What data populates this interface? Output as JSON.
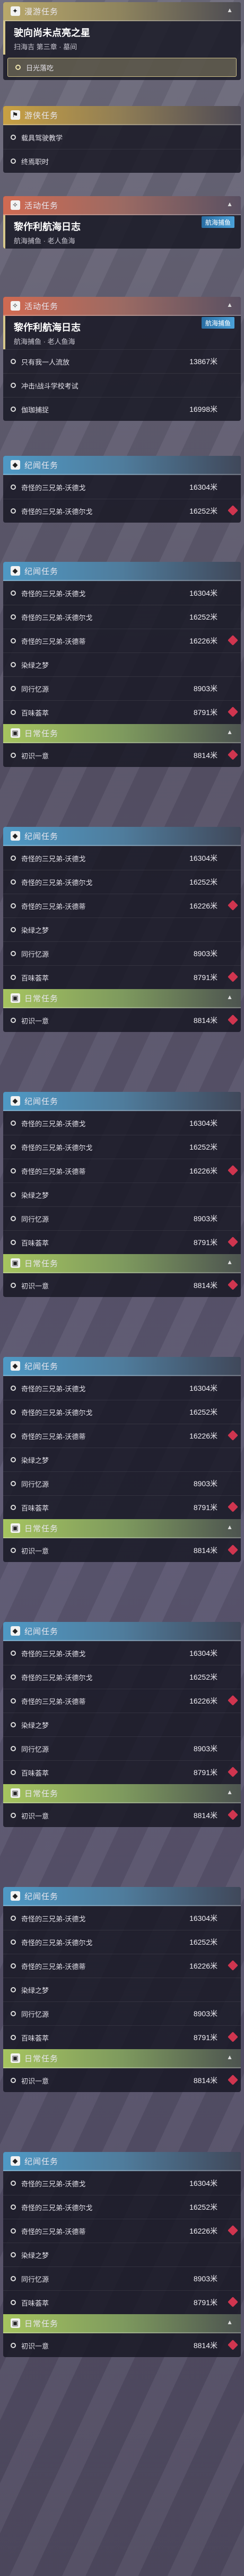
{
  "labels": {
    "tutorial": "漫游任务",
    "side": "游侠任务",
    "event": "活动任务",
    "daily": "日常任务",
    "bond": "纪闻任务",
    "track": "航海捕鱼"
  },
  "tutorial": {
    "title": "驶向尚未点亮之星",
    "sub": "扫海吉 第三章 · 墓间",
    "selected": "日光落吃"
  },
  "side": {
    "items": [
      "载具驾驶教学",
      "终焉职时"
    ]
  },
  "event1": {
    "title": "黎作利航海日志",
    "sub": "航海捕鱼 · 老人鱼海"
  },
  "event2": {
    "title": "黎作利航海日志",
    "sub": "航海捕鱼 · 老人鱼海",
    "items": [
      {
        "label": "只有我一人流放",
        "dist": "13867米"
      },
      {
        "label": "冲击!战斗学校考试",
        "dist": ""
      },
      {
        "label": "伽珈捕捉",
        "dist": "16998米"
      }
    ]
  },
  "bond": {
    "items": [
      {
        "label": "奇怪的三兄弟-沃德戈",
        "dist": "16304米"
      },
      {
        "label": "奇怪的三兄弟-沃德尔戈",
        "dist": "16252米"
      }
    ]
  },
  "group": {
    "items": [
      {
        "label": "奇怪的三兄弟-沃德戈",
        "dist": "16304米"
      },
      {
        "label": "奇怪的三兄弟-沃德尔戈",
        "dist": "16252米"
      },
      {
        "label": "奇怪的三兄弟-沃德蒂",
        "dist": "16226米"
      },
      {
        "label": "染绿之梦",
        "dist": ""
      },
      {
        "label": "同行忆源",
        "dist": "8903米"
      },
      {
        "label": "百味荟萃",
        "dist": "8791米"
      }
    ]
  },
  "daily": {
    "items": [
      {
        "label": "初识一意",
        "dist": "8814米"
      }
    ]
  }
}
